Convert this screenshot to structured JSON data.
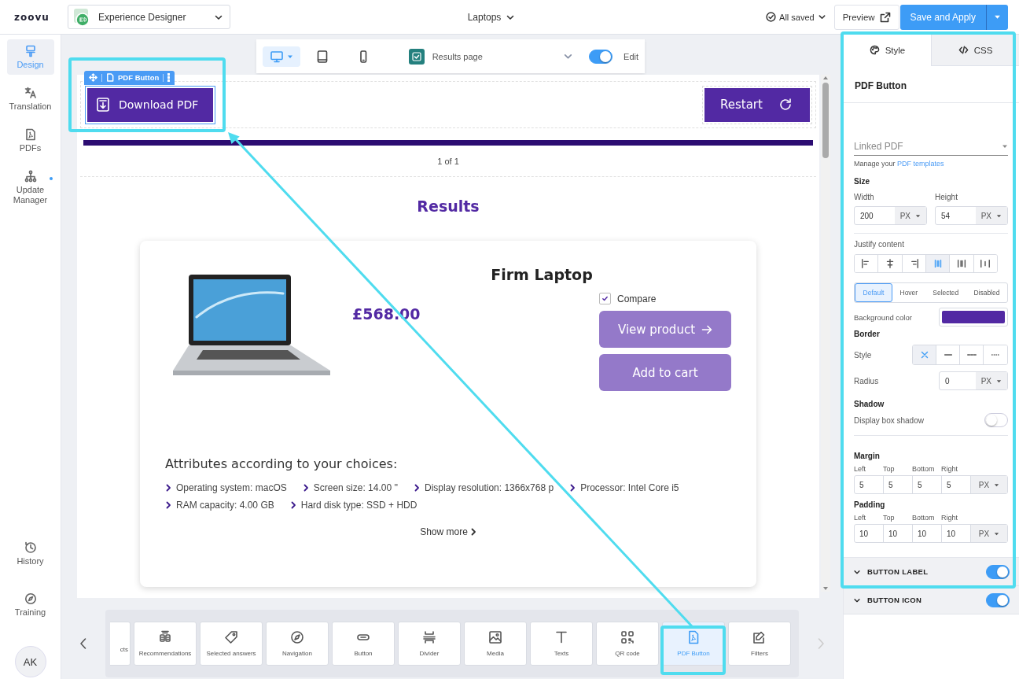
{
  "app": {
    "logo": "zoovu",
    "product_switcher": "Experience Designer",
    "project": "Laptops",
    "save_status": "All saved",
    "preview_button": "Preview",
    "save_button": "Save and Apply"
  },
  "sidebar": {
    "items": [
      {
        "label": "Design",
        "selected": true,
        "badge": false
      },
      {
        "label": "Translation",
        "selected": false,
        "badge": false
      },
      {
        "label": "PDFs",
        "selected": false,
        "badge": false
      },
      {
        "label": "Update Manager",
        "selected": false,
        "badge": true
      }
    ],
    "bottom_items": [
      {
        "label": "History"
      },
      {
        "label": "Training"
      }
    ],
    "avatar": "AK"
  },
  "canvas_toolbar": {
    "devices": [
      {
        "selected": true
      },
      {
        "selected": false
      },
      {
        "selected": false
      }
    ],
    "page": "Results page",
    "edit_mode": {
      "label": "Edit",
      "on": true
    }
  },
  "preview": {
    "selected_component": "PDF Button",
    "pdf_button": "Download PDF",
    "restart_button": "Restart",
    "progress": {
      "level": 1,
      "label": "1 of 1"
    },
    "heading": "Results",
    "product": {
      "name": "Firm Laptop",
      "price": "£568.00",
      "compare": {
        "label": "Compare",
        "checked": true
      },
      "view_button": "View product",
      "cart_button": "Add to cart",
      "attributes_heading": "Attributes according to your choices:",
      "attributes": [
        "Operating system: macOS",
        "Screen size: 14.00 ''",
        "Display resolution: 1366x768 p",
        "Processor: Intel Core i5",
        "RAM capacity: 4.00 GB",
        "Hard disk type: SSD + HDD"
      ],
      "show_more": "Show more"
    }
  },
  "widgets": {
    "items": [
      {
        "label": "cts",
        "selected": false
      },
      {
        "label": "Recommendations",
        "selected": false
      },
      {
        "label": "Selected answers",
        "selected": false
      },
      {
        "label": "Navigation",
        "selected": false
      },
      {
        "label": "Button",
        "selected": false
      },
      {
        "label": "Divider",
        "selected": false
      },
      {
        "label": "Media",
        "selected": false
      },
      {
        "label": "Texts",
        "selected": false
      },
      {
        "label": "QR code",
        "selected": false
      },
      {
        "label": "PDF Button",
        "selected": true
      },
      {
        "label": "Filters",
        "selected": false
      }
    ]
  },
  "inspector": {
    "tabs": [
      {
        "label": "Style",
        "selected": true
      },
      {
        "label": "CSS",
        "selected": false
      }
    ],
    "title": "PDF Button",
    "linked_pdf": {
      "placeholder": "Linked PDF"
    },
    "manage_prefix": "Manage your",
    "manage_link": "PDF templates",
    "size": {
      "label": "Size",
      "width": {
        "label": "Width",
        "value": "200",
        "unit": "PX"
      },
      "height": {
        "label": "Height",
        "value": "54",
        "unit": "PX"
      }
    },
    "justify": {
      "label": "Justify content",
      "options": [
        {
          "selected": false
        },
        {
          "selected": false
        },
        {
          "selected": false
        },
        {
          "selected": true
        },
        {
          "selected": false
        },
        {
          "selected": false
        }
      ]
    },
    "states": [
      {
        "label": "Default",
        "selected": true
      },
      {
        "label": "Hover",
        "selected": false
      },
      {
        "label": "Selected",
        "selected": false
      },
      {
        "label": "Disabled",
        "selected": false
      }
    ],
    "background": {
      "label": "Background color",
      "color": "#5229a3"
    },
    "border": {
      "label": "Border",
      "style_label": "Style",
      "styles": [
        {
          "selected": true
        },
        {
          "selected": false
        },
        {
          "selected": false
        },
        {
          "selected": false
        }
      ],
      "radius_label": "Radius",
      "radius": "0",
      "radius_unit": "PX"
    },
    "shadow": {
      "label": "Shadow",
      "toggle_label": "Display box shadow",
      "on": false
    },
    "margin": {
      "label": "Margin",
      "sides": [
        {
          "label": "Left",
          "value": "5"
        },
        {
          "label": "Top",
          "value": "5"
        },
        {
          "label": "Bottom",
          "value": "5"
        },
        {
          "label": "Right",
          "value": "5"
        }
      ],
      "unit": "PX"
    },
    "padding": {
      "label": "Padding",
      "sides": [
        {
          "label": "Left",
          "value": "10"
        },
        {
          "label": "Top",
          "value": "10"
        },
        {
          "label": "Bottom",
          "value": "10"
        },
        {
          "label": "Right",
          "value": "10"
        }
      ],
      "unit": "PX"
    },
    "sections": [
      {
        "label": "BUTTON LABEL",
        "on": true
      },
      {
        "label": "BUTTON ICON",
        "on": true
      }
    ]
  }
}
